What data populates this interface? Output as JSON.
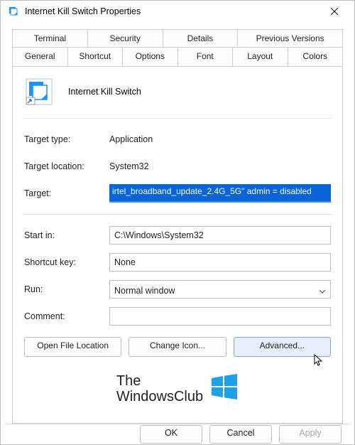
{
  "title": "Internet Kill Switch Properties",
  "tabs_top": [
    "Terminal",
    "Security",
    "Details",
    "Previous Versions"
  ],
  "tabs_bottom": [
    "General",
    "Shortcut",
    "Options",
    "Font",
    "Layout",
    "Colors"
  ],
  "active_tab": "Shortcut",
  "header_name": "Internet Kill Switch",
  "labels": {
    "target_type": "Target type:",
    "target_location": "Target location:",
    "target": "Target:",
    "start_in": "Start in:",
    "shortcut_key": "Shortcut key:",
    "run": "Run:",
    "comment": "Comment:"
  },
  "values": {
    "target_type": "Application",
    "target_location": "System32",
    "target": "irtel_broadband_update_2.4G_5G\" admin = disabled",
    "start_in": "C:\\Windows\\System32",
    "shortcut_key": "None",
    "run": "Normal window",
    "comment": ""
  },
  "buttons": {
    "open_file_location": "Open File Location",
    "change_icon": "Change Icon...",
    "advanced": "Advanced..."
  },
  "footer": {
    "ok": "OK",
    "cancel": "Cancel",
    "apply": "Apply"
  },
  "watermark_line1": "The",
  "watermark_line2": "WindowsClub"
}
